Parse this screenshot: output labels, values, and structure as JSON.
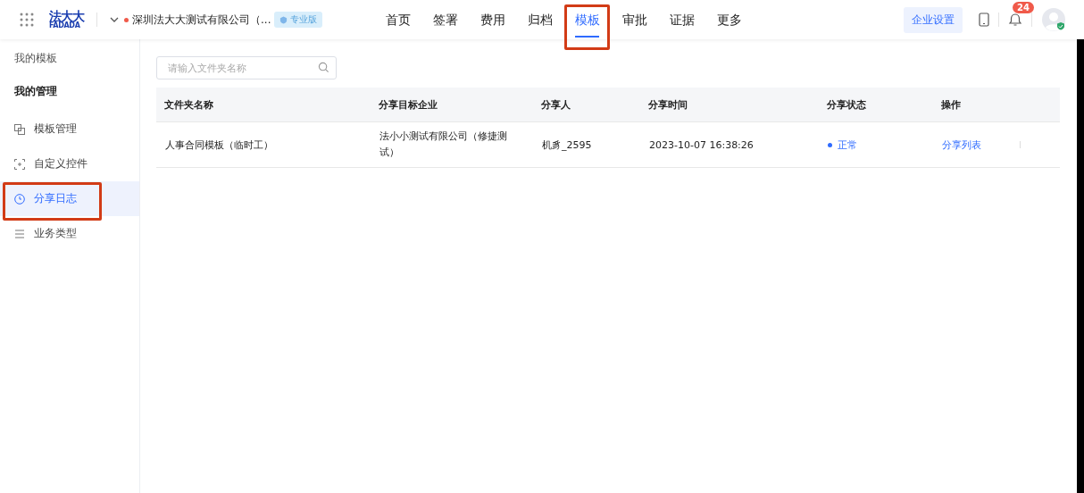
{
  "header": {
    "logo_top": "法大大",
    "logo_bottom": "FADADA",
    "company": "深圳法大大测试有限公司（...",
    "edition_badge": "专业版",
    "nav": [
      {
        "label": "首页",
        "selected": false,
        "highlighted": false
      },
      {
        "label": "签署",
        "selected": false,
        "highlighted": false
      },
      {
        "label": "费用",
        "selected": false,
        "highlighted": false
      },
      {
        "label": "归档",
        "selected": false,
        "highlighted": false
      },
      {
        "label": "模板",
        "selected": true,
        "highlighted": true
      },
      {
        "label": "审批",
        "selected": false,
        "highlighted": false
      },
      {
        "label": "证据",
        "selected": false,
        "highlighted": false
      },
      {
        "label": "更多",
        "selected": false,
        "highlighted": false
      }
    ],
    "settings_button": "企业设置",
    "notification_count": "24"
  },
  "sidebar": {
    "items": [
      {
        "kind": "heading",
        "label": "我的模板"
      },
      {
        "kind": "group",
        "label": "我的管理"
      },
      {
        "kind": "item",
        "label": "模板管理",
        "selected": false,
        "highlighted": false
      },
      {
        "kind": "item",
        "label": "自定义控件",
        "selected": false,
        "highlighted": false
      },
      {
        "kind": "item",
        "label": "分享日志",
        "selected": true,
        "highlighted": true
      },
      {
        "kind": "item",
        "label": "业务类型",
        "selected": false,
        "highlighted": false
      }
    ]
  },
  "search": {
    "placeholder": "请输入文件夹名称"
  },
  "table": {
    "columns": [
      "文件夹名称",
      "分享目标企业",
      "分享人",
      "分享时间",
      "分享状态",
      "操作"
    ],
    "rows": [
      {
        "folder": "人事合同模板（临时工）",
        "target": "法小小测试有限公司（修捷测试）",
        "sharer": "机豸_2595",
        "time": "2023-10-07 16:38:26",
        "status": "正常",
        "color": "#2f6bff",
        "action": "分享列表"
      }
    ]
  }
}
